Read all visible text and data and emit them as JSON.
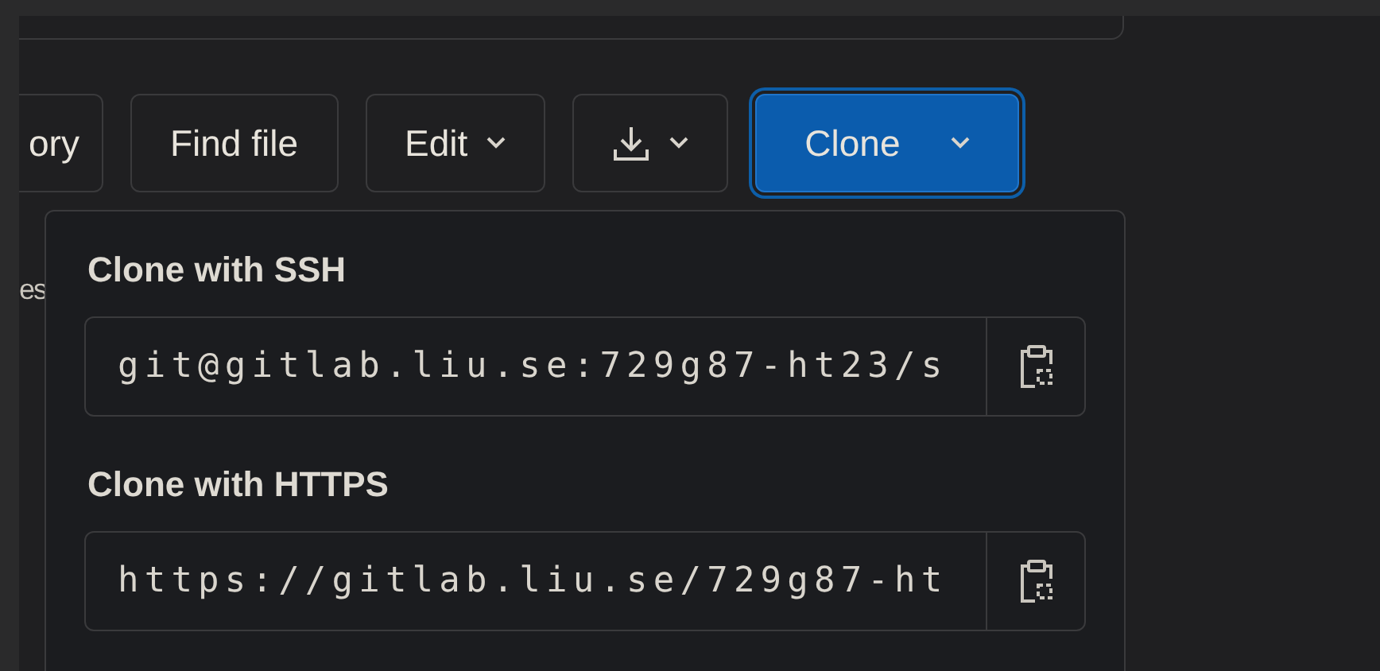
{
  "toolbar": {
    "buttons": [
      {
        "kind": "plain",
        "label": "ory"
      },
      {
        "kind": "plain",
        "label": "Find file"
      },
      {
        "kind": "menu",
        "label": "Edit"
      },
      {
        "kind": "download-menu"
      },
      {
        "kind": "primary-menu",
        "label": "Clone",
        "expanded": true
      }
    ]
  },
  "background_text": "es",
  "clone_menu": {
    "sections": [
      {
        "title": "Clone with SSH",
        "value": "git@gitlab.liu.se:729g87-ht23/s"
      },
      {
        "title": "Clone with HTTPS",
        "value": "https://gitlab.liu.se/729g87-ht"
      }
    ]
  }
}
